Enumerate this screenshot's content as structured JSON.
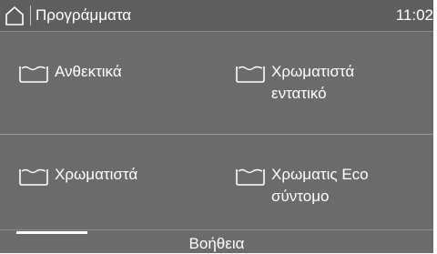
{
  "header": {
    "title": "Προγράμματα",
    "time": "11:02",
    "home_icon": "home-icon"
  },
  "programs": [
    {
      "label": "Ανθεκτικά",
      "icon": "washtub-icon"
    },
    {
      "label": "Χρωματιστά\nεντατικό",
      "icon": "washtub-icon"
    },
    {
      "label": "Χρωματιστά",
      "icon": "washtub-icon"
    },
    {
      "label": "Χρωματις Eco\nσύντομο",
      "icon": "washtub-icon"
    }
  ],
  "footer": {
    "help_label": "Βοήθεια"
  },
  "colors": {
    "background": "#6b6b6b",
    "header": "#5e5e5e",
    "text": "#ffffff"
  }
}
